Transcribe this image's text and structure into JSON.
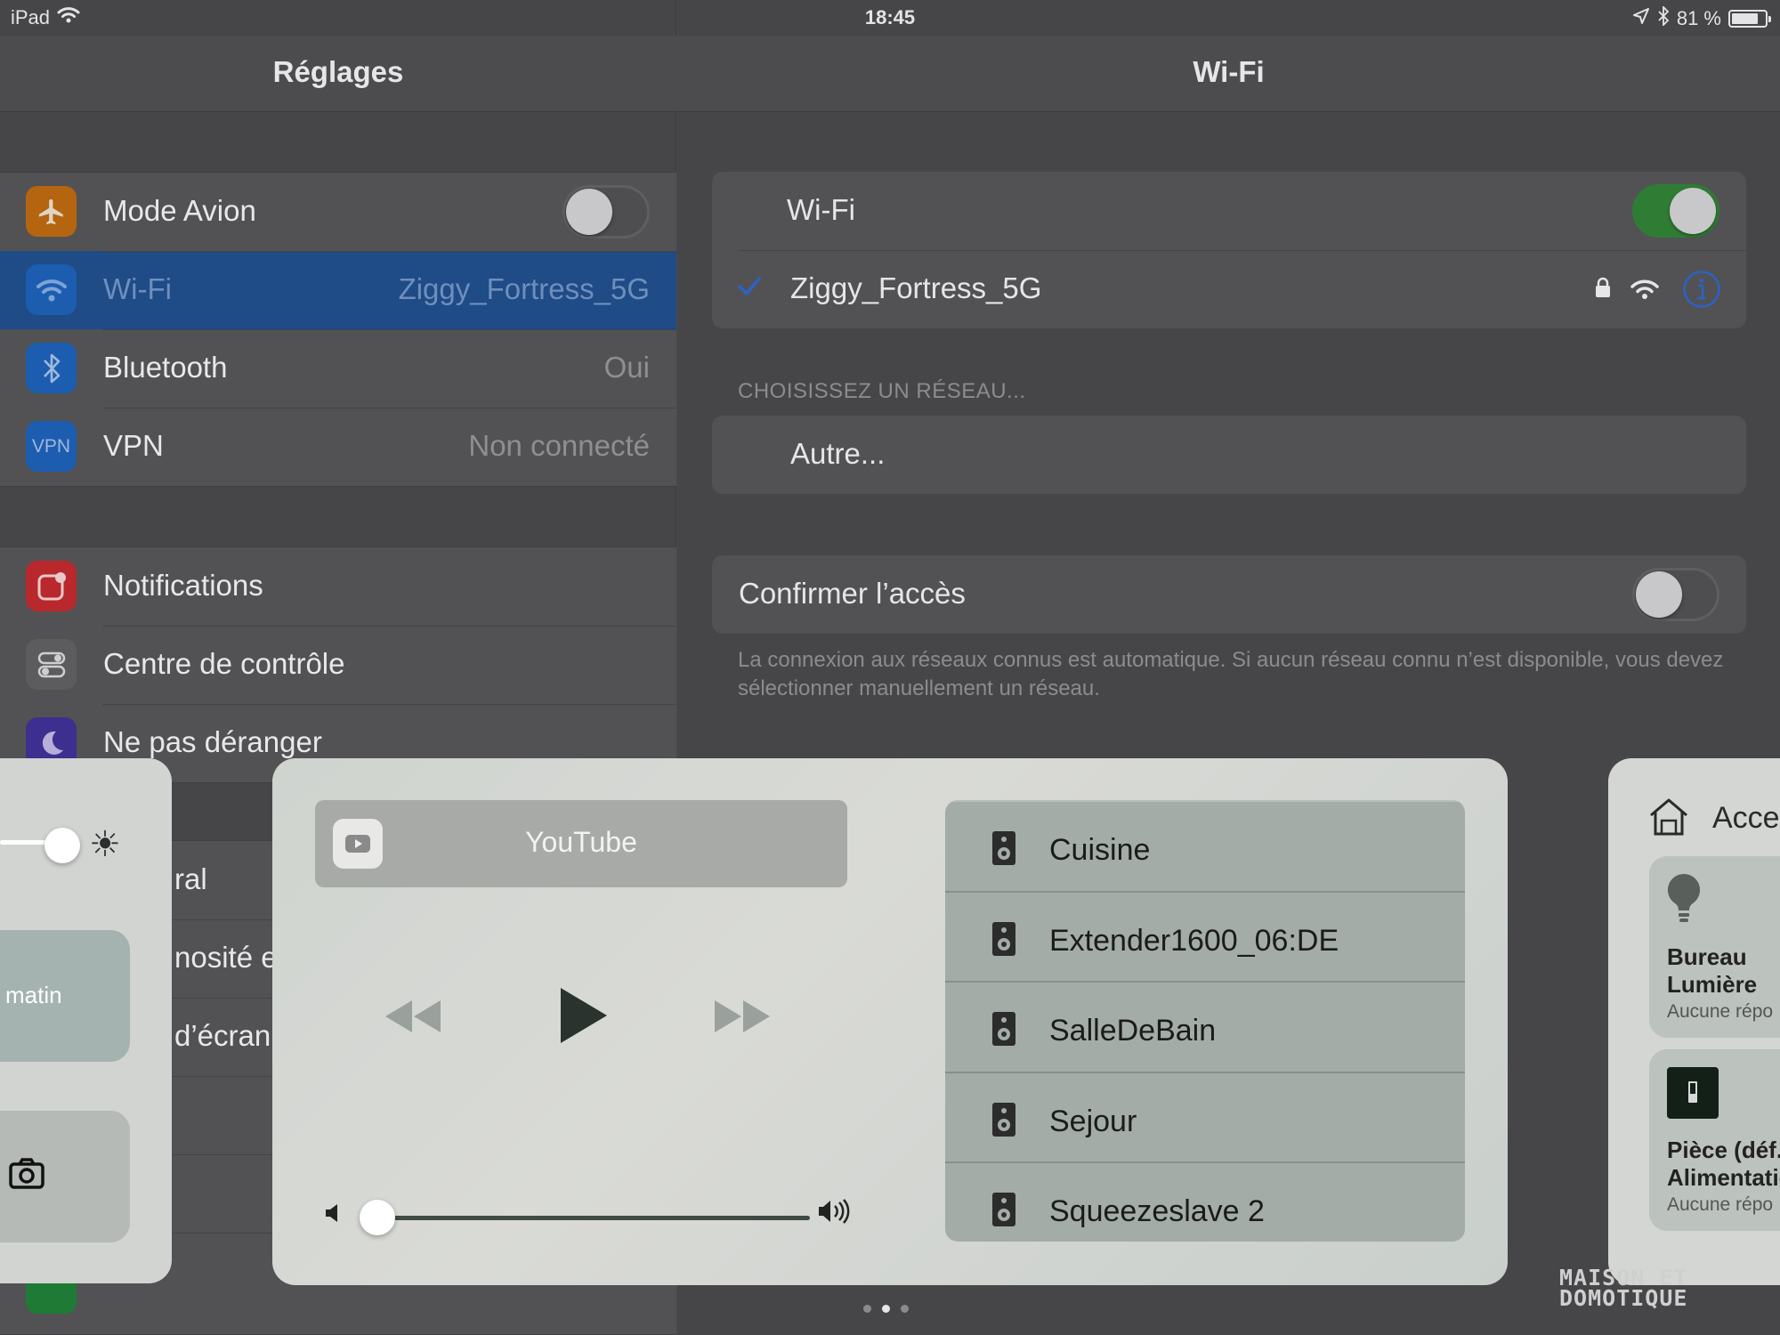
{
  "status_bar": {
    "device": "iPad",
    "time": "18:45",
    "battery": "81 %",
    "battery_level": 0.81
  },
  "left_pane": {
    "title": "Réglages",
    "group1": [
      {
        "label": "Mode Avion",
        "value": "",
        "icon": "airplane-icon",
        "icon_color": "#b5650f",
        "toggle": false
      },
      {
        "label": "Wi-Fi",
        "value": "Ziggy_Fortress_5G",
        "icon": "wifi-icon",
        "icon_color": "#1c5db0",
        "selected": true
      },
      {
        "label": "Bluetooth",
        "value": "Oui",
        "icon": "bluetooth-icon",
        "icon_color": "#1c5db0"
      },
      {
        "label": "VPN",
        "value": "Non connecté",
        "icon": "vpn-icon",
        "icon_color": "#1c5db0"
      }
    ],
    "group2": [
      {
        "label": "Notifications",
        "icon": "notifications-icon",
        "icon_color": "#b8282c"
      },
      {
        "label": "Centre de contrôle",
        "icon": "control-center-icon",
        "icon_color": "#5c5c5e"
      },
      {
        "label": "Ne pas déranger",
        "icon": "moon-icon",
        "icon_color": "#3d2f8f"
      }
    ],
    "partial_labels": [
      "ral",
      "nosité e",
      "d’écran"
    ]
  },
  "right_pane": {
    "title": "Wi-Fi",
    "wifi_label": "Wi-Fi",
    "wifi_on": true,
    "connected_network": "Ziggy_Fortress_5G",
    "choose_header": "CHOISISSEZ UN RÉSEAU...",
    "other_label": "Autre...",
    "confirm_label": "Confirmer l’accès",
    "confirm_on": false,
    "footnote": "La connexion aux réseaux connus est automatique. Si aucun réseau connu n’est disponible, vous devez sélectionner manuellement un réseau."
  },
  "control_center": {
    "brightness_level": 0.9,
    "nightshift_label": "matin",
    "media": {
      "source": "YouTube",
      "volume_level": 0.03
    },
    "speakers": [
      "Cuisine",
      "Extender1600_06:DE",
      "SalleDeBain",
      "Sejour",
      "Squeezeslave 2"
    ],
    "home": {
      "header": "Acce",
      "tiles": [
        {
          "name": "Bureau\nLumière",
          "status": "Aucune répo",
          "icon": "lightbulb-icon"
        },
        {
          "name": "Pièce (déf.\nAlimentatio",
          "status": "Aucune répo",
          "icon": "outlet-icon"
        }
      ]
    },
    "page_count": 3,
    "active_page": 2
  },
  "watermark": {
    "line1": "MAISON ET",
    "line2": "DOMOTIQUE"
  },
  "colors": {
    "accent_blue": "#1f4b86",
    "toggle_green": "#2f7d34",
    "info_blue": "#2b62c6"
  }
}
